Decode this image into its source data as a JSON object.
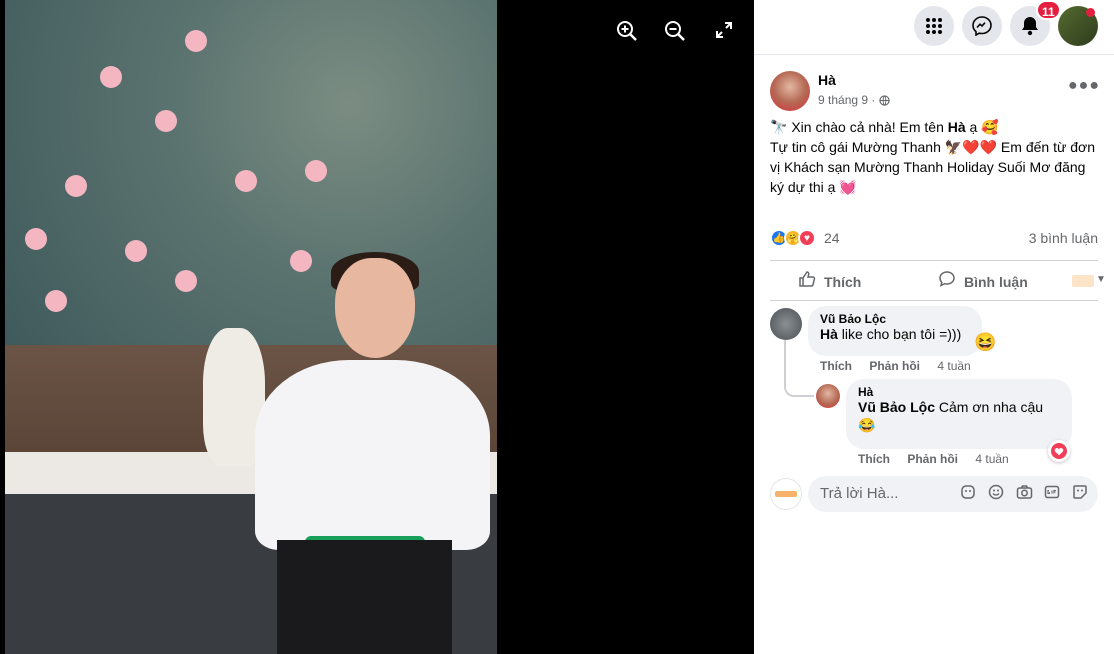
{
  "viewer": {
    "zoom_in_icon": "zoom-in-icon",
    "zoom_out_icon": "zoom-out-icon",
    "fullscreen_icon": "fullscreen-icon"
  },
  "topbar": {
    "notification_count": "11"
  },
  "post": {
    "author": "Hà",
    "date": "9 tháng 9",
    "privacy_icon": "globe-icon",
    "text_line1_pre": "Xin chào cả nhà! Em tên ",
    "text_line1_bold": "Hà",
    "text_line1_post": " ạ 🥰",
    "text_line2": "Tự tin cô gái Mường Thanh 🦅❤️❤️ Em đến từ đơn vị Khách sạn Mường Thanh Holiday Suối Mơ đăng ký dự thi ạ 💓",
    "reaction_count": "24",
    "comment_count": "3 bình luận",
    "like_label": "Thích",
    "comment_label": "Bình luận"
  },
  "comments": [
    {
      "author": "Vũ Bảo Lộc",
      "tag": "Hà",
      "text": " like cho bạn tôi =)))",
      "like": "Thích",
      "reply": "Phản hồi",
      "time": "4 tuần"
    },
    {
      "author": "Hà",
      "tag": "Vũ Bảo Lộc",
      "text": " Cảm ơn nha cậu",
      "like": "Thích",
      "reply": "Phản hồi",
      "time": "4 tuần"
    }
  ],
  "reply": {
    "placeholder": "Trả lời Hà..."
  },
  "colors": {
    "like_blue": "#1877f2",
    "love_red": "#f33e58",
    "badge_red": "#e41e3f"
  }
}
